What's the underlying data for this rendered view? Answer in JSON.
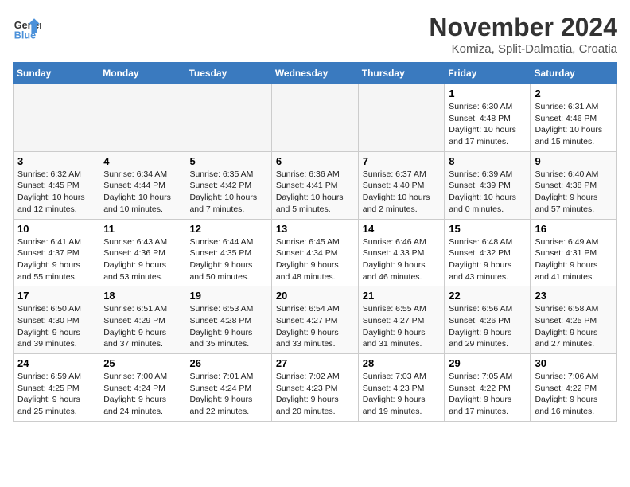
{
  "header": {
    "logo_line1": "General",
    "logo_line2": "Blue",
    "month": "November 2024",
    "location": "Komiza, Split-Dalmatia, Croatia"
  },
  "weekdays": [
    "Sunday",
    "Monday",
    "Tuesday",
    "Wednesday",
    "Thursday",
    "Friday",
    "Saturday"
  ],
  "weeks": [
    [
      {
        "day": "",
        "info": ""
      },
      {
        "day": "",
        "info": ""
      },
      {
        "day": "",
        "info": ""
      },
      {
        "day": "",
        "info": ""
      },
      {
        "day": "",
        "info": ""
      },
      {
        "day": "1",
        "info": "Sunrise: 6:30 AM\nSunset: 4:48 PM\nDaylight: 10 hours and 17 minutes."
      },
      {
        "day": "2",
        "info": "Sunrise: 6:31 AM\nSunset: 4:46 PM\nDaylight: 10 hours and 15 minutes."
      }
    ],
    [
      {
        "day": "3",
        "info": "Sunrise: 6:32 AM\nSunset: 4:45 PM\nDaylight: 10 hours and 12 minutes."
      },
      {
        "day": "4",
        "info": "Sunrise: 6:34 AM\nSunset: 4:44 PM\nDaylight: 10 hours and 10 minutes."
      },
      {
        "day": "5",
        "info": "Sunrise: 6:35 AM\nSunset: 4:42 PM\nDaylight: 10 hours and 7 minutes."
      },
      {
        "day": "6",
        "info": "Sunrise: 6:36 AM\nSunset: 4:41 PM\nDaylight: 10 hours and 5 minutes."
      },
      {
        "day": "7",
        "info": "Sunrise: 6:37 AM\nSunset: 4:40 PM\nDaylight: 10 hours and 2 minutes."
      },
      {
        "day": "8",
        "info": "Sunrise: 6:39 AM\nSunset: 4:39 PM\nDaylight: 10 hours and 0 minutes."
      },
      {
        "day": "9",
        "info": "Sunrise: 6:40 AM\nSunset: 4:38 PM\nDaylight: 9 hours and 57 minutes."
      }
    ],
    [
      {
        "day": "10",
        "info": "Sunrise: 6:41 AM\nSunset: 4:37 PM\nDaylight: 9 hours and 55 minutes."
      },
      {
        "day": "11",
        "info": "Sunrise: 6:43 AM\nSunset: 4:36 PM\nDaylight: 9 hours and 53 minutes."
      },
      {
        "day": "12",
        "info": "Sunrise: 6:44 AM\nSunset: 4:35 PM\nDaylight: 9 hours and 50 minutes."
      },
      {
        "day": "13",
        "info": "Sunrise: 6:45 AM\nSunset: 4:34 PM\nDaylight: 9 hours and 48 minutes."
      },
      {
        "day": "14",
        "info": "Sunrise: 6:46 AM\nSunset: 4:33 PM\nDaylight: 9 hours and 46 minutes."
      },
      {
        "day": "15",
        "info": "Sunrise: 6:48 AM\nSunset: 4:32 PM\nDaylight: 9 hours and 43 minutes."
      },
      {
        "day": "16",
        "info": "Sunrise: 6:49 AM\nSunset: 4:31 PM\nDaylight: 9 hours and 41 minutes."
      }
    ],
    [
      {
        "day": "17",
        "info": "Sunrise: 6:50 AM\nSunset: 4:30 PM\nDaylight: 9 hours and 39 minutes."
      },
      {
        "day": "18",
        "info": "Sunrise: 6:51 AM\nSunset: 4:29 PM\nDaylight: 9 hours and 37 minutes."
      },
      {
        "day": "19",
        "info": "Sunrise: 6:53 AM\nSunset: 4:28 PM\nDaylight: 9 hours and 35 minutes."
      },
      {
        "day": "20",
        "info": "Sunrise: 6:54 AM\nSunset: 4:27 PM\nDaylight: 9 hours and 33 minutes."
      },
      {
        "day": "21",
        "info": "Sunrise: 6:55 AM\nSunset: 4:27 PM\nDaylight: 9 hours and 31 minutes."
      },
      {
        "day": "22",
        "info": "Sunrise: 6:56 AM\nSunset: 4:26 PM\nDaylight: 9 hours and 29 minutes."
      },
      {
        "day": "23",
        "info": "Sunrise: 6:58 AM\nSunset: 4:25 PM\nDaylight: 9 hours and 27 minutes."
      }
    ],
    [
      {
        "day": "24",
        "info": "Sunrise: 6:59 AM\nSunset: 4:25 PM\nDaylight: 9 hours and 25 minutes."
      },
      {
        "day": "25",
        "info": "Sunrise: 7:00 AM\nSunset: 4:24 PM\nDaylight: 9 hours and 24 minutes."
      },
      {
        "day": "26",
        "info": "Sunrise: 7:01 AM\nSunset: 4:24 PM\nDaylight: 9 hours and 22 minutes."
      },
      {
        "day": "27",
        "info": "Sunrise: 7:02 AM\nSunset: 4:23 PM\nDaylight: 9 hours and 20 minutes."
      },
      {
        "day": "28",
        "info": "Sunrise: 7:03 AM\nSunset: 4:23 PM\nDaylight: 9 hours and 19 minutes."
      },
      {
        "day": "29",
        "info": "Sunrise: 7:05 AM\nSunset: 4:22 PM\nDaylight: 9 hours and 17 minutes."
      },
      {
        "day": "30",
        "info": "Sunrise: 7:06 AM\nSunset: 4:22 PM\nDaylight: 9 hours and 16 minutes."
      }
    ]
  ]
}
